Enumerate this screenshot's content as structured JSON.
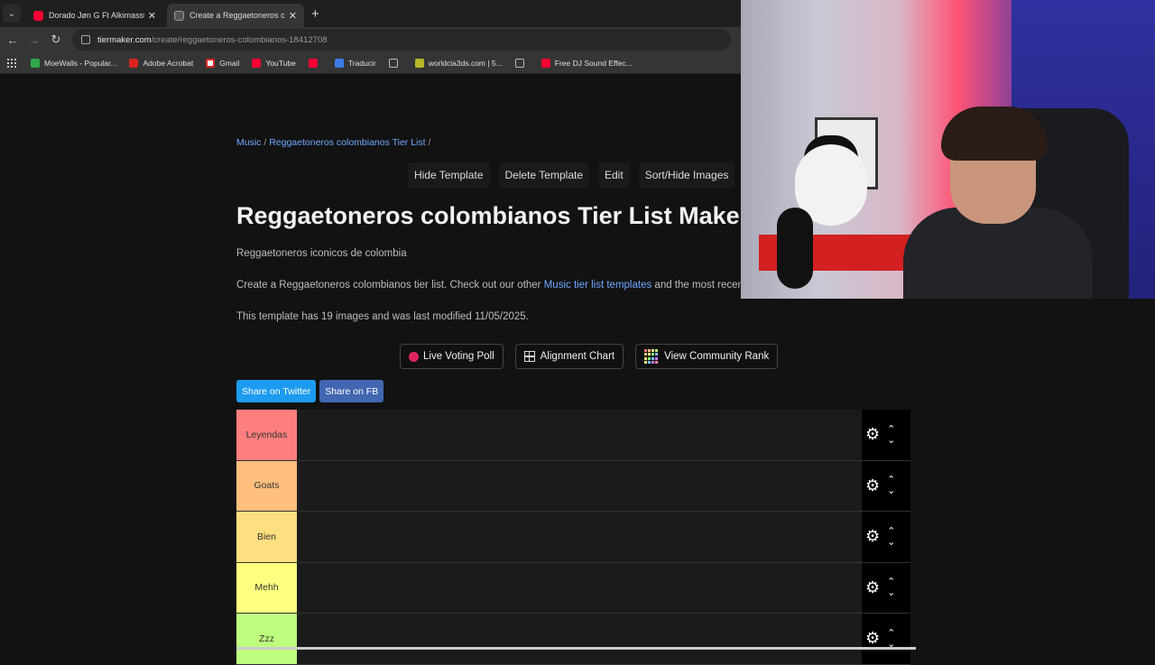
{
  "browser": {
    "tabs": [
      {
        "title": "Dorado Jøn G Ft Alkimassta (Vi",
        "active": false
      },
      {
        "title": "Create a Reggaetoneros colomb",
        "active": true
      }
    ],
    "url_host": "tiermaker.com",
    "url_path": "/create/reggaetoneros-colombianos-18412708",
    "bookmarks": [
      "MoeWalls - Popular...",
      "Adobe Acrobat",
      "Gmail",
      "YouTube",
      "",
      "Traducir",
      "",
      "worldcia3ds.com | 5...",
      "",
      "Free DJ Sound Effec..."
    ]
  },
  "page": {
    "breadcrumb": {
      "music": "Music",
      "sep1": " / ",
      "list": "Reggaetoneros colombianos Tier List",
      "sep2": " /"
    },
    "actions": [
      "Hide Template",
      "Delete Template",
      "Edit",
      "Sort/Hide Images"
    ],
    "title": "Reggaetoneros colombianos Tier List Maker",
    "description": "Reggaetoneros iconicos de colombia",
    "info_prefix": "Create a Reggaetoneros colombianos tier list. Check out our other ",
    "info_link": "Music tier list templates",
    "info_suffix": " and the most recent",
    "meta": "This template has 19 images and was last modified 11/05/2025.",
    "feature_buttons": {
      "poll": "Live Voting Poll",
      "alignment": "Alignment Chart",
      "community": "View Community Rank"
    },
    "share": {
      "twitter": "Share on Twitter",
      "fb": "Share on FB"
    },
    "tiers": [
      {
        "label": "Leyendas",
        "color": "#ff7f7f"
      },
      {
        "label": "Goats",
        "color": "#ffbf7f"
      },
      {
        "label": "Bien",
        "color": "#ffdf7f"
      },
      {
        "label": "Mehh",
        "color": "#ffff7f"
      },
      {
        "label": "Zzz",
        "color": "#bfff7f"
      }
    ]
  }
}
